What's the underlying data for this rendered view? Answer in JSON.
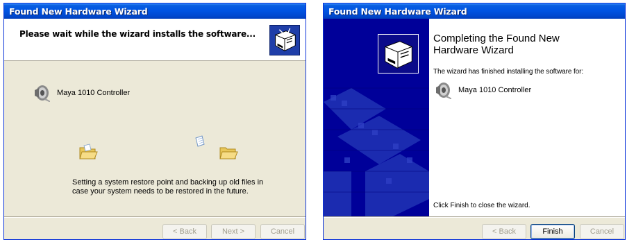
{
  "left_window": {
    "title": "Found New Hardware Wizard",
    "header_title": "Please wait while the wizard installs the software...",
    "device_name": "Maya 1010 Controller",
    "status_text": "Setting a system restore point and backing up old files in case your system needs to be restored in the future.",
    "buttons": {
      "back": "< Back",
      "next": "Next >",
      "cancel": "Cancel"
    }
  },
  "right_window": {
    "title": "Found New Hardware Wizard",
    "heading": "Completing the Found New Hardware Wizard",
    "finished_text": "The wizard has finished installing the software for:",
    "device_name": "Maya 1010 Controller",
    "close_hint": "Click Finish to close the wizard.",
    "buttons": {
      "back": "< Back",
      "finish": "Finish",
      "cancel": "Cancel"
    }
  },
  "colors": {
    "titlebar": "#0054e3",
    "window_bg": "#ece9d8",
    "side_panel": "#000099",
    "button_border": "#003c74"
  },
  "icons": [
    "hardware-wizard-logo-icon",
    "speaker-icon",
    "folder-icon",
    "paper-icon"
  ]
}
